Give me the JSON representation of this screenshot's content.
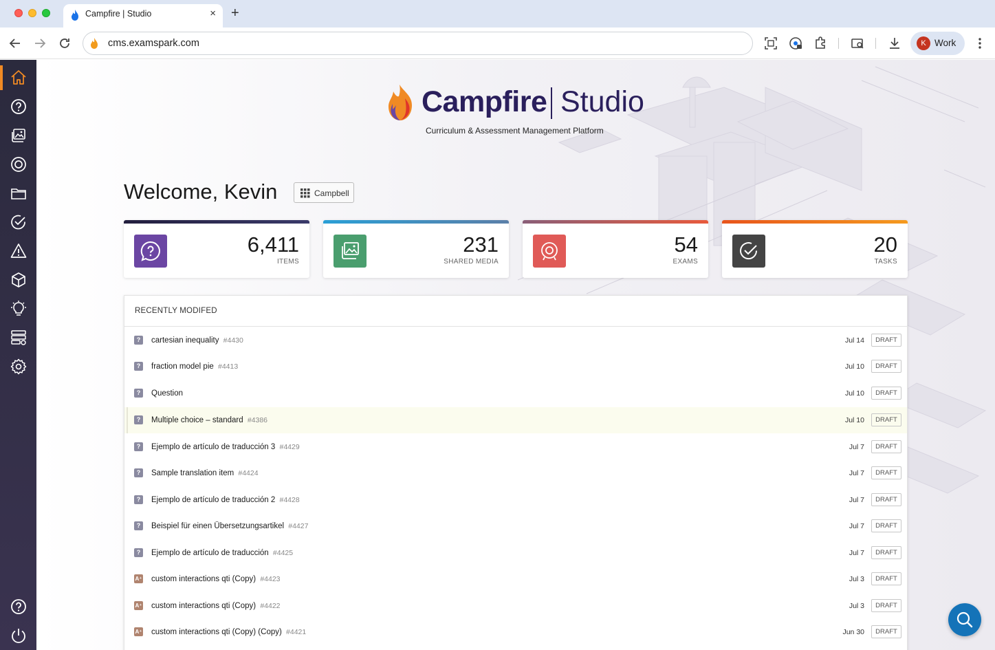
{
  "browser": {
    "tab_title": "Campfire | Studio",
    "tab_close": "×",
    "new_tab": "+",
    "url": "cms.examspark.com",
    "profile_initial": "K",
    "profile_label": "Work"
  },
  "sidebar": {
    "items": [
      {
        "icon": "home-icon",
        "active": true
      },
      {
        "icon": "question-icon"
      },
      {
        "icon": "media-icon"
      },
      {
        "icon": "target-icon"
      },
      {
        "icon": "folder-icon"
      },
      {
        "icon": "check-circle-icon"
      },
      {
        "icon": "warning-icon"
      },
      {
        "icon": "cube-icon"
      },
      {
        "icon": "lightbulb-icon"
      },
      {
        "icon": "server-settings-icon"
      },
      {
        "icon": "gear-icon"
      }
    ],
    "bottom": [
      {
        "icon": "help-icon"
      },
      {
        "icon": "power-icon"
      }
    ]
  },
  "header": {
    "logo_word": "Campfire",
    "logo_product": "Studio",
    "tagline": "Curriculum & Assessment Management Platform"
  },
  "welcome": {
    "text": "Welcome, Kevin",
    "org_label": "Campbell"
  },
  "stats": [
    {
      "value": "6,411",
      "label": "ITEMS",
      "icon": "question-bubble-icon",
      "color": "#6b46a3",
      "bar": "#2a2550"
    },
    {
      "value": "231",
      "label": "SHARED MEDIA",
      "icon": "images-icon",
      "color": "#4a9e6e",
      "bar": "#3b8fc4"
    },
    {
      "value": "54",
      "label": "EXAMS",
      "icon": "target-icon",
      "color": "#e05a57",
      "bar": "#e05a4c"
    },
    {
      "value": "20",
      "label": "TASKS",
      "icon": "check-circle-icon",
      "color": "#444444",
      "bar": "#f07a18"
    }
  ],
  "recent": {
    "title": "RECENTLY MODIFED",
    "rows": [
      {
        "type": "q",
        "badge": "?",
        "title": "cartesian inequality",
        "id": "#4430",
        "date": "Jul 14",
        "status": "DRAFT"
      },
      {
        "type": "q",
        "badge": "?",
        "title": "fraction model pie",
        "id": "#4413",
        "date": "Jul 10",
        "status": "DRAFT"
      },
      {
        "type": "q",
        "badge": "?",
        "title": "Question",
        "id": "",
        "date": "Jul 10",
        "status": "DRAFT"
      },
      {
        "type": "q",
        "badge": "?",
        "title": "Multiple choice – standard",
        "id": "#4386",
        "date": "Jul 10",
        "status": "DRAFT",
        "highlight": true
      },
      {
        "type": "q",
        "badge": "?",
        "title": "Ejemplo de artículo de traducción 3",
        "id": "#4429",
        "date": "Jul 7",
        "status": "DRAFT"
      },
      {
        "type": "q",
        "badge": "?",
        "title": "Sample translation item",
        "id": "#4424",
        "date": "Jul 7",
        "status": "DRAFT"
      },
      {
        "type": "q",
        "badge": "?",
        "title": "Ejemplo de artículo de traducción 2",
        "id": "#4428",
        "date": "Jul 7",
        "status": "DRAFT"
      },
      {
        "type": "q",
        "badge": "?",
        "title": "Beispiel für einen Übersetzungsartikel",
        "id": "#4427",
        "date": "Jul 7",
        "status": "DRAFT"
      },
      {
        "type": "q",
        "badge": "?",
        "title": "Ejemplo de artículo de traducción",
        "id": "#4425",
        "date": "Jul 7",
        "status": "DRAFT"
      },
      {
        "type": "a",
        "badge": "A⁺",
        "title": "custom interactions qti (Copy)",
        "id": "#4423",
        "date": "Jul 3",
        "status": "DRAFT"
      },
      {
        "type": "a",
        "badge": "A⁺",
        "title": "custom interactions qti (Copy)",
        "id": "#4422",
        "date": "Jul 3",
        "status": "DRAFT"
      },
      {
        "type": "a",
        "badge": "A⁺",
        "title": "custom interactions qti (Copy) (Copy)",
        "id": "#4421",
        "date": "Jun 30",
        "status": "DRAFT"
      }
    ]
  }
}
